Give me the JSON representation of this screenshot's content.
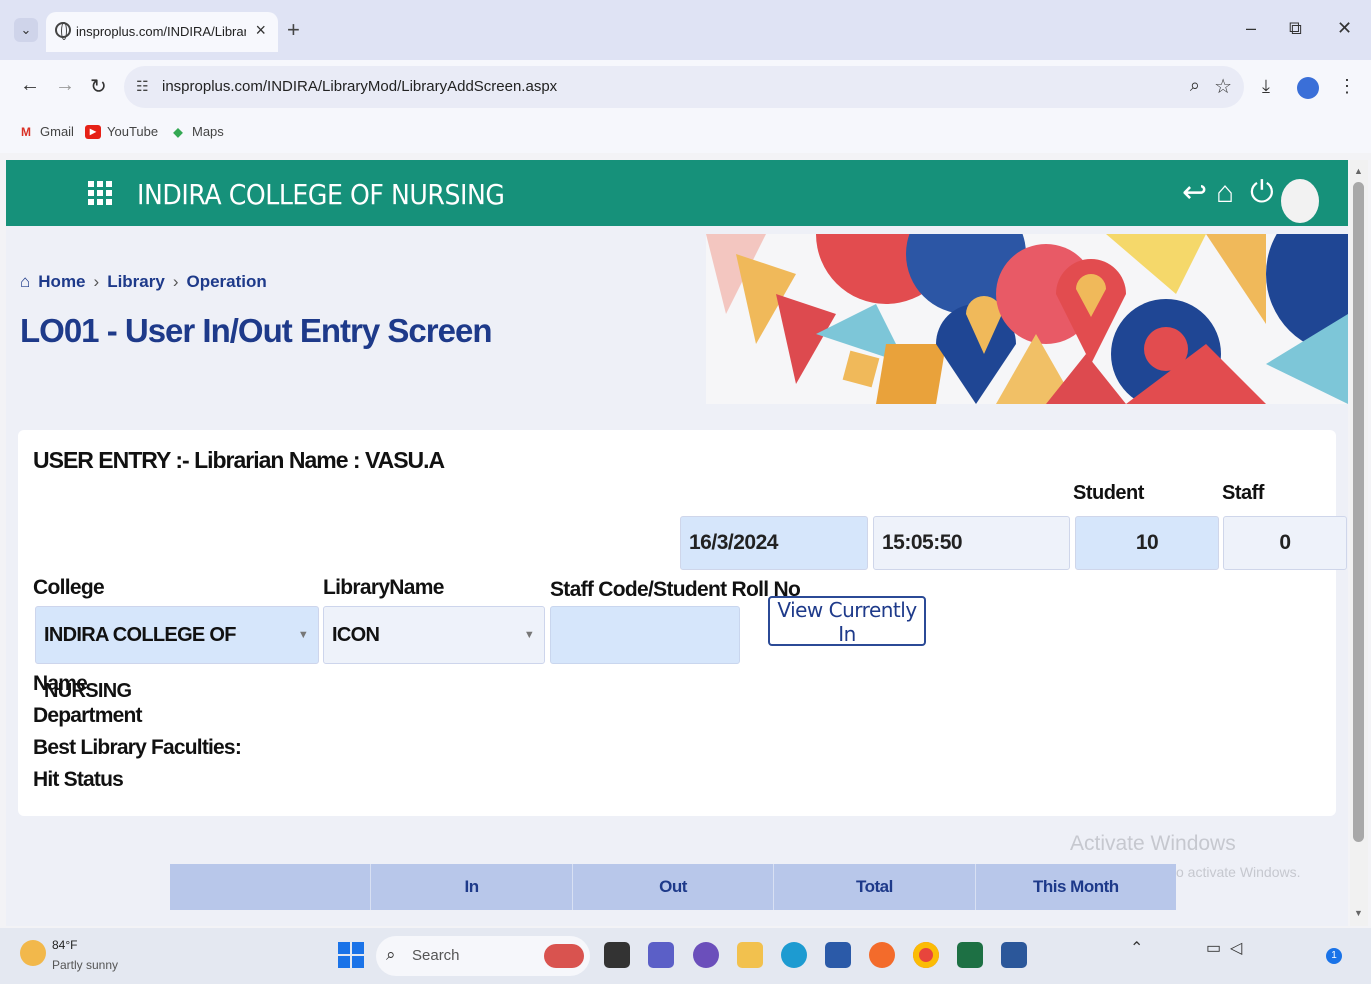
{
  "browser": {
    "tab_title": "insproplus.com/INDIRA/Library",
    "url": "insproplus.com/INDIRA/LibraryMod/LibraryAddScreen.aspx",
    "bookmarks": [
      "Gmail",
      "YouTube",
      "Maps"
    ]
  },
  "app": {
    "title": "INDIRA COLLEGE OF NURSING",
    "accent": "#16917a",
    "link_color": "#1e3a8a"
  },
  "breadcrumb": [
    "Home",
    "Library",
    "Operation"
  ],
  "page_title": "LO01 - User In/Out Entry Screen",
  "entry": {
    "heading": "USER ENTRY :-  Librarian Name :  VASU.A",
    "student_label": "Student",
    "staff_label": "Staff",
    "date": "16/3/2024",
    "time": "15:05:50",
    "student_count": "10",
    "staff_count": "0"
  },
  "form": {
    "college_label": "College",
    "college_value": "INDIRA COLLEGE OF NURSING",
    "library_label": "LibraryName",
    "library_value": "ICON",
    "code_label": "Staff Code/Student Roll No",
    "code_value": "",
    "view_button": "View Currently In"
  },
  "info_labels": [
    "Name",
    "Department",
    "Best Library Faculties:",
    "Hit Status"
  ],
  "summary_headers": [
    "",
    "In",
    "Out",
    "Total",
    "This Month"
  ],
  "watermark": {
    "line1": "Activate Windows",
    "line2": "o activate Windows."
  },
  "taskbar": {
    "temperature": "84°F",
    "weather": "Partly sunny",
    "search": "Search",
    "notification_count": "1"
  }
}
